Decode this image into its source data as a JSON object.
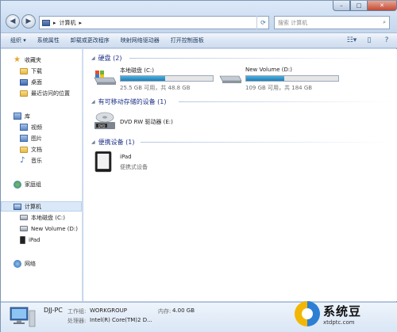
{
  "window": {
    "controls": {
      "min": "–",
      "max": "□",
      "close": "✕"
    }
  },
  "nav": {
    "back": "◀",
    "forward": "▶"
  },
  "address": {
    "crumbs": [
      "计算机"
    ],
    "separator": "▸"
  },
  "search": {
    "placeholder": "搜索 计算机"
  },
  "toolbar": {
    "items": [
      "组织 ▾",
      "系统属性",
      "卸载或更改程序",
      "映射网络驱动器",
      "打开控制面板"
    ]
  },
  "sidebar": {
    "favorites": {
      "label": "收藏夹",
      "items": [
        "下载",
        "桌面",
        "最近访问的位置"
      ]
    },
    "libraries": {
      "label": "库",
      "items": [
        "视频",
        "图片",
        "文档",
        "音乐"
      ]
    },
    "homegroup": "家庭组",
    "computer": {
      "label": "计算机",
      "items": [
        "本地磁盘 (C:)",
        "New Volume (D:)",
        "iPad"
      ]
    },
    "network": "网络"
  },
  "groups": {
    "hard_drives": {
      "title": "硬盘 (2)"
    },
    "removable": {
      "title": "有可移动存储的设备 (1)"
    },
    "portable": {
      "title": "便携设备 (1)"
    }
  },
  "drives": [
    {
      "name": "本地磁盘 (C:)",
      "space": "25.5 GB 可用，共 48.8 GB",
      "used_fraction": 0.48
    },
    {
      "name": "New Volume (D:)",
      "space": "109 GB 可用，共 184 GB",
      "used_fraction": 0.41
    }
  ],
  "dvd": {
    "name": "DVD RW 驱动器 (E:)",
    "badge": "DVD"
  },
  "portable_device": {
    "name": "iPad",
    "type": "便携式设备"
  },
  "details": {
    "pc_name": "DJJ-PC",
    "workgroup_label": "工作组:",
    "workgroup_value": "WORKGROUP",
    "memory_label": "内存:",
    "memory_value": "4.00 GB",
    "processor_label": "处理器:",
    "processor_value": "Intel(R) Core(TM)2 D..."
  },
  "watermark": {
    "title": "系统豆",
    "url": "xtdptc.com"
  },
  "colors": {
    "group_header": "#1e3287",
    "bar_fill": "#1f7db5",
    "selection": "#dbe8f7"
  }
}
